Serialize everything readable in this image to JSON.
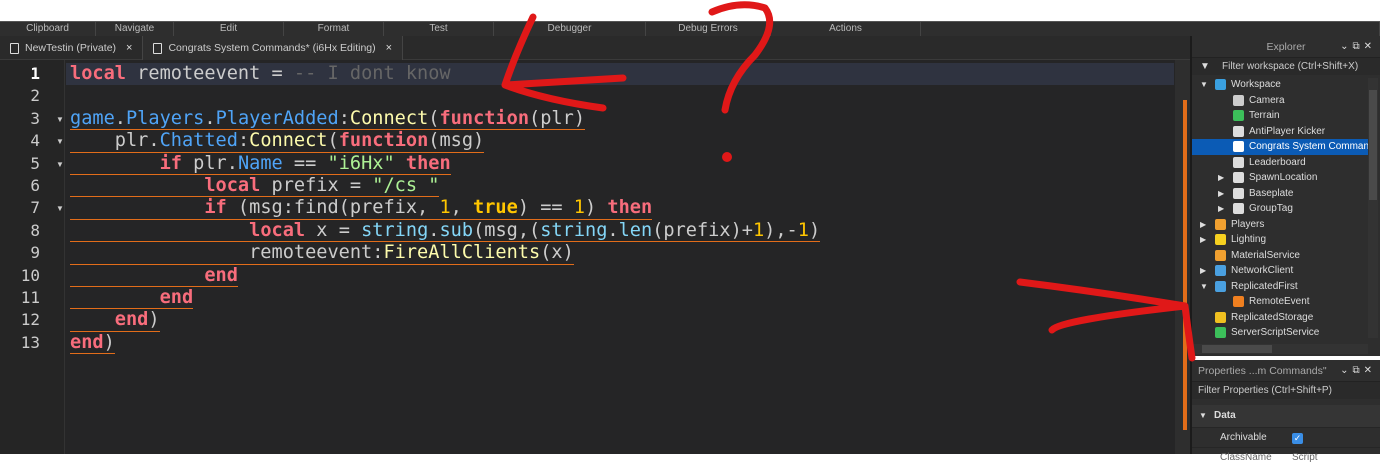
{
  "toolbar": [
    "Clipboard",
    "Navigate",
    "Edit",
    "Format",
    "Test",
    "Debugger",
    "Debug Errors",
    "Actions"
  ],
  "tabs": [
    {
      "label": "NewTestin (Private)",
      "close": "×"
    },
    {
      "label": "Congrats System Commands* (i6Hx Editing)",
      "close": "×"
    }
  ],
  "code": [
    [
      [
        "kw",
        "local"
      ],
      [
        "tx",
        " remoteevent = "
      ],
      [
        "cm",
        "-- I dont know"
      ]
    ],
    [],
    [
      [
        "bl",
        "game"
      ],
      [
        "tx",
        "."
      ],
      [
        "bl",
        "Players"
      ],
      [
        "tx",
        "."
      ],
      [
        "bl",
        "PlayerAdded"
      ],
      [
        "tx",
        ":"
      ],
      [
        "fn",
        "Connect"
      ],
      [
        "tx",
        "("
      ],
      [
        "kw",
        "function"
      ],
      [
        "tx",
        "(plr)"
      ]
    ],
    [
      [
        "tx",
        "    plr."
      ],
      [
        "bl",
        "Chatted"
      ],
      [
        "tx",
        ":"
      ],
      [
        "fn",
        "Connect"
      ],
      [
        "tx",
        "("
      ],
      [
        "kw",
        "function"
      ],
      [
        "tx",
        "(msg)"
      ]
    ],
    [
      [
        "tx",
        "        "
      ],
      [
        "kw",
        "if"
      ],
      [
        "tx",
        " plr."
      ],
      [
        "bl",
        "Name"
      ],
      [
        "tx",
        " == "
      ],
      [
        "st",
        "\"i6Hx\""
      ],
      [
        "tx",
        " "
      ],
      [
        "kw",
        "then"
      ]
    ],
    [
      [
        "tx",
        "            "
      ],
      [
        "kw",
        "local"
      ],
      [
        "tx",
        " prefix = "
      ],
      [
        "st",
        "\"/cs \""
      ]
    ],
    [
      [
        "tx",
        "            "
      ],
      [
        "kw",
        "if"
      ],
      [
        "tx",
        " (msg:find(prefix, "
      ],
      [
        "nu",
        "1"
      ],
      [
        "tx",
        ", "
      ],
      [
        "tr",
        "true"
      ],
      [
        "tx",
        ") == "
      ],
      [
        "nu",
        "1"
      ],
      [
        "tx",
        ") "
      ],
      [
        "kw",
        "then"
      ]
    ],
    [
      [
        "tx",
        "                "
      ],
      [
        "kw",
        "local"
      ],
      [
        "tx",
        " x = "
      ],
      [
        "sb",
        "string"
      ],
      [
        "tx",
        "."
      ],
      [
        "sb",
        "sub"
      ],
      [
        "tx",
        "(msg,("
      ],
      [
        "sb",
        "string"
      ],
      [
        "tx",
        "."
      ],
      [
        "sb",
        "len"
      ],
      [
        "tx",
        "(prefix)+"
      ],
      [
        "nu",
        "1"
      ],
      [
        "tx",
        "),-"
      ],
      [
        "nu",
        "1"
      ],
      [
        "tx",
        ")"
      ]
    ],
    [
      [
        "tx",
        "                remoteevent:"
      ],
      [
        "fn",
        "FireAllClients"
      ],
      [
        "tx",
        "(x)"
      ]
    ],
    [
      [
        "tx",
        "            "
      ],
      [
        "kw",
        "end"
      ]
    ],
    [
      [
        "tx",
        "        "
      ],
      [
        "kw",
        "end"
      ]
    ],
    [
      [
        "tx",
        "    "
      ],
      [
        "kw",
        "end"
      ],
      [
        "tx",
        ")"
      ]
    ],
    [
      [
        "kw",
        "end"
      ],
      [
        "tx",
        ")"
      ]
    ]
  ],
  "explorer": {
    "title": "Explorer",
    "filter": "Filter workspace (Ctrl+Shift+X)",
    "items": [
      {
        "label": "Workspace",
        "level": 0,
        "arrow": "open",
        "icon": "globe-icon",
        "color": "#3aa0e0"
      },
      {
        "label": "Camera",
        "level": 1,
        "arrow": "",
        "icon": "camera-icon",
        "color": "#ccc"
      },
      {
        "label": "Terrain",
        "level": 1,
        "arrow": "",
        "icon": "terrain-icon",
        "color": "#3cbf5a"
      },
      {
        "label": "AntiPlayer Kicker",
        "level": 1,
        "arrow": "",
        "icon": "script-icon",
        "color": "#ddd"
      },
      {
        "label": "Congrats System Commands",
        "level": 1,
        "arrow": "",
        "icon": "script-icon",
        "color": "#fff",
        "selected": true
      },
      {
        "label": "Leaderboard",
        "level": 1,
        "arrow": "",
        "icon": "script-icon",
        "color": "#ddd"
      },
      {
        "label": "SpawnLocation",
        "level": 1,
        "arrow": "closed",
        "icon": "gear-icon",
        "color": "#ddd"
      },
      {
        "label": "Baseplate",
        "level": 1,
        "arrow": "closed",
        "icon": "part-icon",
        "color": "#ddd"
      },
      {
        "label": "GroupTag",
        "level": 1,
        "arrow": "closed",
        "icon": "part-icon",
        "color": "#ddd"
      },
      {
        "label": "Players",
        "level": 0,
        "arrow": "closed",
        "icon": "players-icon",
        "color": "#f0a030"
      },
      {
        "label": "Lighting",
        "level": 0,
        "arrow": "closed",
        "icon": "bulb-icon",
        "color": "#f5d020"
      },
      {
        "label": "MaterialService",
        "level": 0,
        "arrow": "",
        "icon": "material-icon",
        "color": "#f0a030"
      },
      {
        "label": "NetworkClient",
        "level": 0,
        "arrow": "closed",
        "icon": "network-icon",
        "color": "#4aa0e0"
      },
      {
        "label": "ReplicatedFirst",
        "level": 0,
        "arrow": "open",
        "icon": "replicated-first-icon",
        "color": "#4aa0e0"
      },
      {
        "label": "RemoteEvent",
        "level": 1,
        "arrow": "",
        "icon": "remote-event-icon",
        "color": "#f08020"
      },
      {
        "label": "ReplicatedStorage",
        "level": 0,
        "arrow": "",
        "icon": "storage-icon",
        "color": "#f0c020"
      },
      {
        "label": "ServerScriptService",
        "level": 0,
        "arrow": "",
        "icon": "server-script-icon",
        "color": "#3cbf5a"
      }
    ]
  },
  "properties": {
    "title": "Properties ...m Commands\"",
    "filter": "Filter Properties (Ctrl+Shift+P)",
    "section": "Data",
    "rows": [
      {
        "name": "Archivable",
        "value": "✓"
      },
      {
        "name": "ClassName",
        "value": "Script"
      }
    ]
  },
  "annotation_color": "#e01818"
}
